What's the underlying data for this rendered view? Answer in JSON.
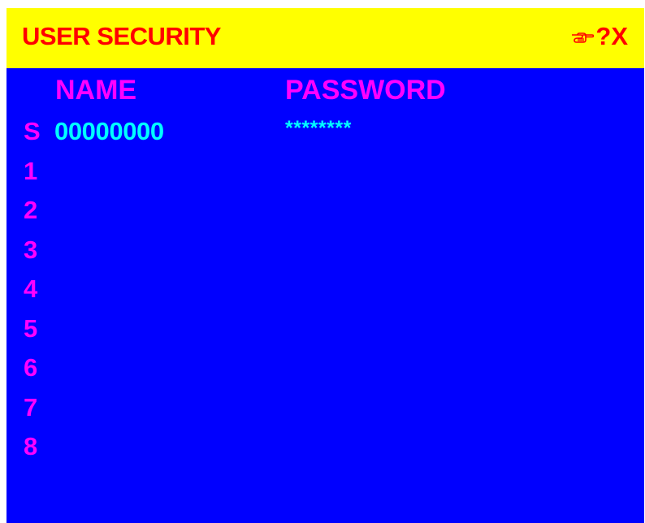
{
  "title": "USER SECURITY",
  "controls": {
    "pointer_icon": "pointing-hand-icon",
    "help_label": "?",
    "close_label": "X"
  },
  "columns": {
    "name": "NAME",
    "password": "PASSWORD"
  },
  "users": [
    {
      "index": "S",
      "name": "00000000",
      "password": "********"
    },
    {
      "index": "1",
      "name": "",
      "password": ""
    },
    {
      "index": "2",
      "name": "",
      "password": ""
    },
    {
      "index": "3",
      "name": "",
      "password": ""
    },
    {
      "index": "4",
      "name": "",
      "password": ""
    },
    {
      "index": "5",
      "name": "",
      "password": ""
    },
    {
      "index": "6",
      "name": "",
      "password": ""
    },
    {
      "index": "7",
      "name": "",
      "password": ""
    },
    {
      "index": "8",
      "name": "",
      "password": ""
    }
  ],
  "colors": {
    "background": "#0000ff",
    "title_bar": "#ffff00",
    "title_text": "#ff0000",
    "label": "#ff00ff",
    "value": "#00ffff"
  }
}
